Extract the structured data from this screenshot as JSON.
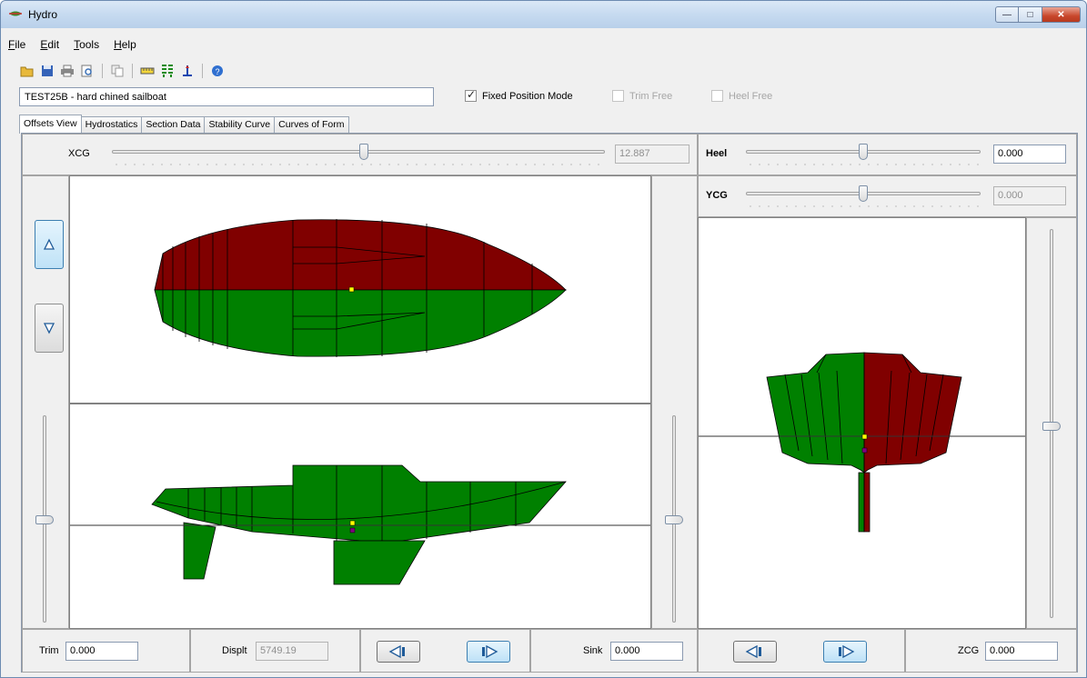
{
  "window": {
    "title": "Hydro"
  },
  "menu": [
    "File",
    "Edit",
    "Tools",
    "Help"
  ],
  "toolbar_icons": [
    "open-folder-icon",
    "save-icon",
    "print-icon",
    "print-preview-icon",
    "copy-icon",
    "ruler-icon",
    "waterlines-icon",
    "anchor-icon",
    "help-icon"
  ],
  "design_name": "TEST25B - hard chined sailboat",
  "options": {
    "fixed_position": {
      "label": "Fixed Position Mode",
      "checked": true
    },
    "trim_free": {
      "label": "Trim Free",
      "checked": false
    },
    "heel_free": {
      "label": "Heel Free",
      "checked": false
    }
  },
  "tabs": [
    "Offsets View",
    "Hydrostatics",
    "Section Data",
    "Stability Curve",
    "Curves of Form"
  ],
  "xcg": {
    "label": "XCG",
    "value": "12.887"
  },
  "heel": {
    "label": "Heel",
    "value": "0.000"
  },
  "ycg": {
    "label": "YCG",
    "value": "0.000"
  },
  "bottom": {
    "trim_label": "Trim",
    "trim_value": "0.000",
    "displt_label": "Displt",
    "displt_value": "5749.19",
    "sink_label": "Sink",
    "sink_value": "0.000",
    "zcg_label": "ZCG",
    "zcg_value": "0.000"
  },
  "colors": {
    "hull_above": "#800000",
    "hull_below": "#008000",
    "marker_cg": "#ffff00",
    "marker_cb": "#800080"
  }
}
